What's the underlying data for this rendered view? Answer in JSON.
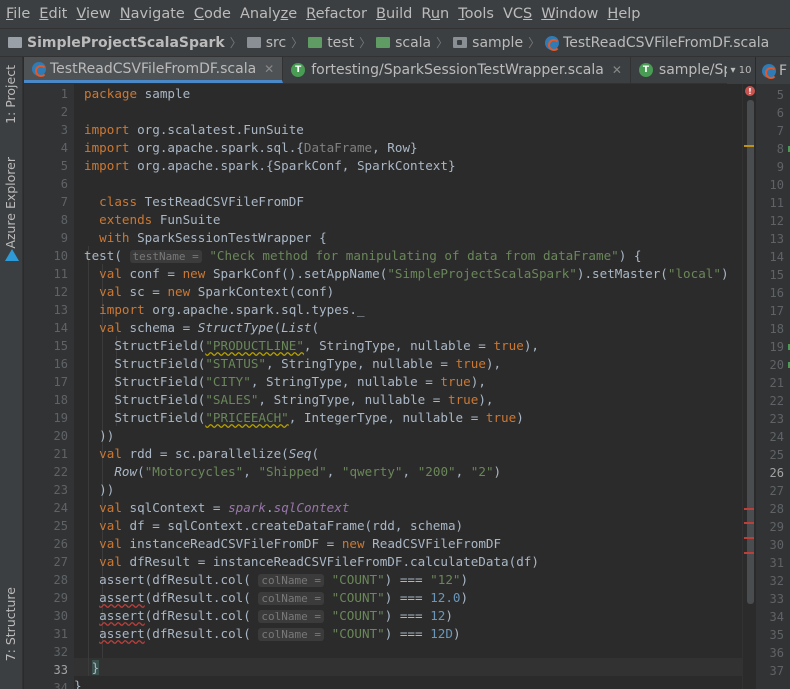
{
  "menu": [
    "File",
    "Edit",
    "View",
    "Navigate",
    "Code",
    "Analyze",
    "Refactor",
    "Build",
    "Run",
    "Tools",
    "VCS",
    "Window",
    "Help"
  ],
  "menu_mnemonics": [
    "F",
    "E",
    "V",
    "N",
    "C",
    "z",
    "R",
    "B",
    "u",
    "T",
    "S",
    "W",
    "H"
  ],
  "breadcrumb": [
    "SimpleProjectScalaSpark",
    "src",
    "test",
    "scala",
    "sample",
    "TestReadCSVFileFromDF.scala"
  ],
  "left_tools": [
    "1: Project",
    "Azure Explorer",
    "7: Structure"
  ],
  "tabs": [
    {
      "label": "TestReadCSVFileFromDF.scala",
      "icon": "scala-file-icon",
      "active": true
    },
    {
      "label": "fortesting/SparkSessionTestWrapper.scala",
      "icon": "test-file-icon",
      "active": false
    },
    {
      "label": "sample/SparkS",
      "icon": "test-file-icon",
      "active": false
    }
  ],
  "tab_overflow": "▾ 10",
  "right_pane_tab": "F",
  "editor": {
    "current_line": 33,
    "line_numbers": [
      "1",
      "2",
      "3",
      "4",
      "5",
      "6",
      "7",
      "8",
      "9",
      "10",
      "11",
      "12",
      "13",
      "14",
      "15",
      "16",
      "17",
      "18",
      "19",
      "20",
      "21",
      "22",
      "23",
      "24",
      "25",
      "26",
      "27",
      "28",
      "29",
      "30",
      "31",
      "32",
      "33",
      "34"
    ],
    "inlay_hints": {
      "test_name": "testName =",
      "col_name": "colName ="
    },
    "code": {
      "l1": "sample",
      "l3": "org.scalatest.FunSuite",
      "l4a": "org.apache.spark.sql.{",
      "l4b": "DataFrame",
      "l4c": ", Row}",
      "l5": "org.apache.spark.{SparkConf, SparkContext}",
      "l7": "TestReadCSVFileFromDF",
      "l8": "FunSuite",
      "l9": "SparkSessionTestWrapper {",
      "l10": "\"Check method for manipulating of data from dataFrame\"",
      "l11a": "conf = ",
      "l11b": "SparkConf().setAppName(",
      "l11c": "\"SimpleProjectScalaSpark\"",
      "l11d": ").setMaster(",
      "l11e": "\"local\"",
      "l12a": "sc = ",
      "l12b": "SparkContext(conf)",
      "l13": "org.apache.spark.sql.types._",
      "l14a": "schema = ",
      "l14b": "StructType",
      "l14c": "List",
      "fields": [
        {
          "name": "\"PRODUCTLINE\"",
          "type": "StringType",
          "val": "true"
        },
        {
          "name": "\"STATUS\"",
          "type": "StringType",
          "val": "true"
        },
        {
          "name": "\"CITY\"",
          "type": "StringType",
          "val": "true"
        },
        {
          "name": "\"SALES\"",
          "type": "StringType",
          "val": "true"
        },
        {
          "name": "\"PRICEEACH\"",
          "type": "IntegerType",
          "val": "true"
        }
      ],
      "l20": "))",
      "l21a": "rdd = sc.parallelize(",
      "l21b": "Seq",
      "l22a": "Row",
      "l22b": "\"Motorcycles\"",
      "l22c": "\"Shipped\"",
      "l22d": "\"qwerty\"",
      "l22e": "\"200\"",
      "l22f": "\"2\"",
      "l23": "))",
      "l24a": "sqlContext = ",
      "l24b": "spark",
      "l24c": ".",
      "l24d": "sqlContext",
      "l25": "df = sqlContext.createDataFrame(rdd, schema)",
      "l26a": "instanceReadCSVFileFromDF = ",
      "l26b": "ReadCSVFileFromDF",
      "l27": "dfResult = instanceReadCSVFileFromDF.calculateData(df)",
      "col": "\"COUNT\"",
      "assert_vals": [
        "\"12\"",
        "12.0",
        "12",
        "12D"
      ],
      "l33": "}",
      "l34": "}"
    }
  },
  "right_pane_lines": [
    "5",
    "6",
    "7",
    "8",
    "9",
    "10",
    "11",
    "12",
    "13",
    "14",
    "15",
    "16",
    "17",
    "18",
    "19",
    "20",
    "21",
    "22",
    "23",
    "24",
    "25",
    "26",
    "27",
    "28",
    "29",
    "30",
    "31",
    "32",
    "33",
    "34",
    "35",
    "36",
    "37"
  ],
  "right_pane_current": "26",
  "colors": {
    "keyword": "#cc7832",
    "string": "#6a8759",
    "number": "#6897bb",
    "field": "#9876aa",
    "error": "#c75450",
    "accent": "#4a88c7"
  }
}
